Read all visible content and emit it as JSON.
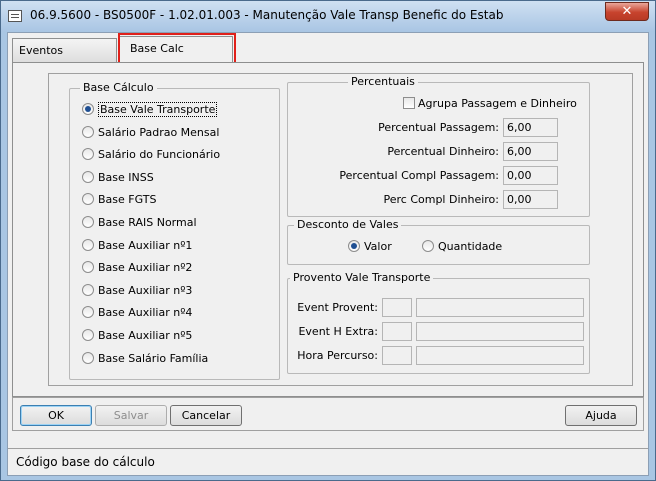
{
  "window": {
    "title": "06.9.5600 - BS0500F - 1.02.01.003 - Manutenção Vale Transp Benefic do Estab",
    "close_glyph": "✕"
  },
  "tabs": [
    {
      "label": "Eventos",
      "selected": false
    },
    {
      "label": "Base Calc",
      "selected": true
    }
  ],
  "base_calculo": {
    "legend": "Base Cálculo",
    "options": [
      {
        "label": "Base Vale Transporte",
        "selected": true
      },
      {
        "label": "Salário Padrao Mensal",
        "selected": false
      },
      {
        "label": "Salário do Funcionário",
        "selected": false
      },
      {
        "label": "Base INSS",
        "selected": false
      },
      {
        "label": "Base FGTS",
        "selected": false
      },
      {
        "label": "Base RAIS Normal",
        "selected": false
      },
      {
        "label": "Base Auxiliar nº1",
        "selected": false
      },
      {
        "label": "Base Auxiliar nº2",
        "selected": false
      },
      {
        "label": "Base Auxiliar nº3",
        "selected": false
      },
      {
        "label": "Base Auxiliar nº4",
        "selected": false
      },
      {
        "label": "Base Auxiliar nº5",
        "selected": false
      },
      {
        "label": "Base Salário Família",
        "selected": false
      }
    ]
  },
  "percentuais": {
    "legend": "Percentuais",
    "agrupa_label": "Agrupa Passagem e Dinheiro",
    "agrupa_checked": false,
    "fields": [
      {
        "label": "Percentual Passagem:",
        "value": "6,00"
      },
      {
        "label": "Percentual Dinheiro:",
        "value": "6,00"
      },
      {
        "label": "Percentual Compl Passagem:",
        "value": "0,00"
      },
      {
        "label": "Perc Compl Dinheiro:",
        "value": "0,00"
      }
    ]
  },
  "desconto": {
    "legend": "Desconto de Vales",
    "valor_label": "Valor",
    "quantidade_label": "Quantidade",
    "selected": "Valor"
  },
  "provento": {
    "legend": "Provento Vale Transporte",
    "fields": [
      {
        "label": "Event Provent:",
        "code": "",
        "description": ""
      },
      {
        "label": "Event H Extra:",
        "code": "",
        "description": ""
      },
      {
        "label": "Hora Percurso:",
        "code": "",
        "description": ""
      }
    ]
  },
  "buttons": {
    "ok": "OK",
    "salvar": "Salvar",
    "cancelar": "Cancelar",
    "ajuda": "Ajuda"
  },
  "status": {
    "text": "Código base do cálculo"
  }
}
